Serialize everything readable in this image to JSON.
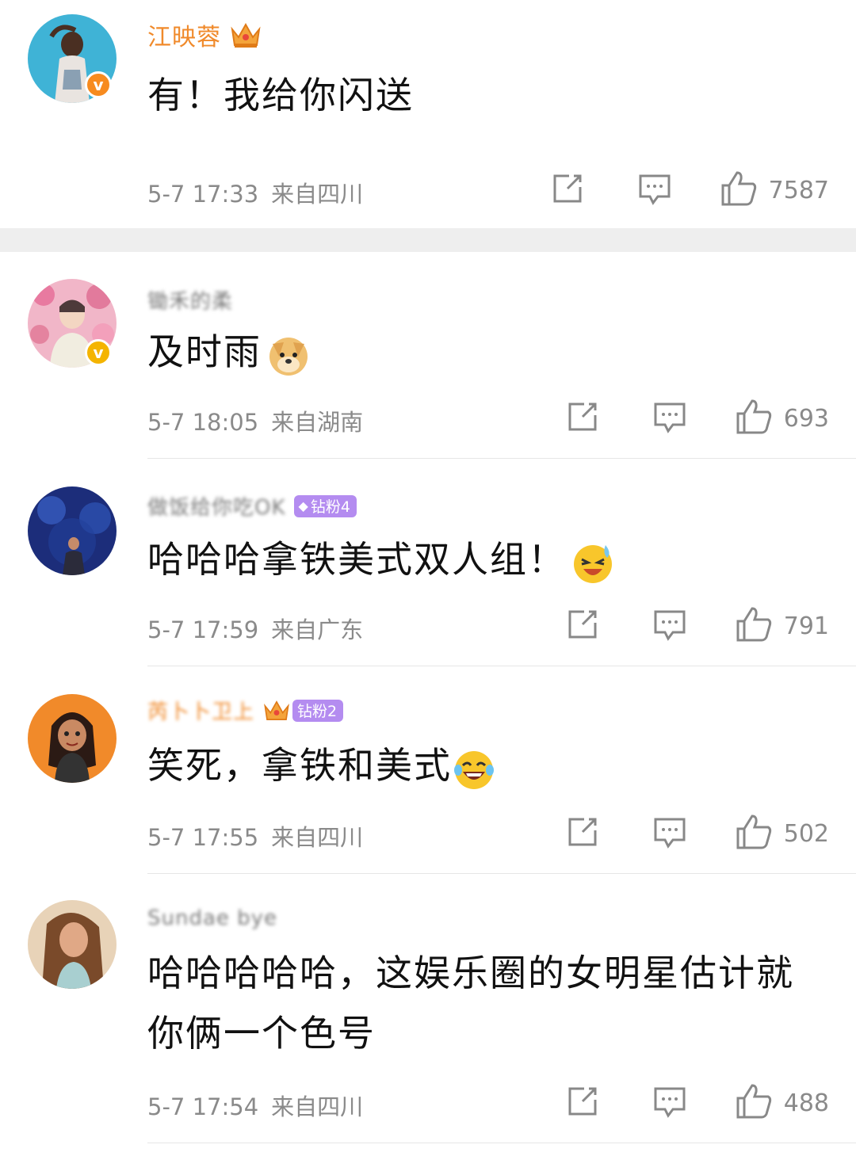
{
  "comments": [
    {
      "username": "江映蓉",
      "badge": "",
      "text": "有！我给你闪送",
      "date": "5-7 17:33",
      "location": "来自四川",
      "likes": "7587",
      "verified_color": "#f78b1f"
    },
    {
      "username": "锄禾的柔",
      "badge": "",
      "text": "及时雨",
      "date": "5-7 18:05",
      "location": "来自湖南",
      "likes": "693",
      "verified_color": "#f4b400"
    },
    {
      "username": "做饭给你吃OK",
      "badge": "钻粉4",
      "text": "哈哈哈拿铁美式双人组！",
      "date": "5-7 17:59",
      "location": "来自广东",
      "likes": "791"
    },
    {
      "username": "芮卜卜卫上",
      "badge": "钻粉2",
      "text": "笑死，拿铁和美式",
      "date": "5-7 17:55",
      "location": "来自四川",
      "likes": "502"
    },
    {
      "username": "Sundae bye",
      "badge": "",
      "text": "哈哈哈哈哈，这娱乐圈的女明星估计就你俩一个色号",
      "date": "5-7 17:54",
      "location": "来自四川",
      "likes": "488"
    }
  ]
}
